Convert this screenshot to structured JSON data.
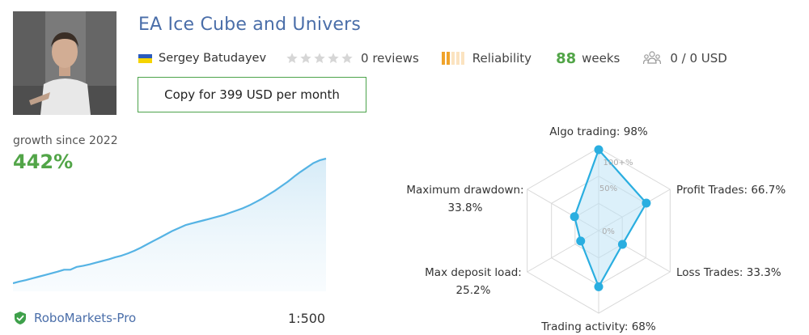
{
  "signal": {
    "title": "EA Ice Cube and Univers",
    "author": "Sergey Batudayev",
    "rating_stars": 0,
    "reviews": "0 reviews",
    "reliability_label": "Reliability",
    "weeks_value": "88",
    "weeks_label": "weeks",
    "subscribers": "0 / 0 USD",
    "copy_button": "Copy for 399 USD per month",
    "colors": {
      "title": "#4a6ea9",
      "accent_green": "#52a548",
      "reliability_bar": "#f0a32a",
      "chart_line": "#55b3e4"
    }
  },
  "growth": {
    "label": "growth since 2022",
    "value": "442%",
    "series": [
      0,
      6,
      11,
      17,
      23,
      29,
      35,
      41,
      48,
      48,
      58,
      62,
      67,
      73,
      79,
      85,
      92,
      98,
      106,
      115,
      126,
      138,
      150,
      162,
      174,
      186,
      196,
      206,
      212,
      218,
      224,
      230,
      236,
      242,
      250,
      258,
      266,
      276,
      288,
      300,
      314,
      328,
      344,
      360,
      378,
      395,
      410,
      426,
      436,
      442
    ]
  },
  "broker": {
    "name": "RoboMarkets-Pro",
    "leverage": "1:500"
  },
  "radar": {
    "scale_labels": [
      "100+%",
      "50%",
      "0%"
    ],
    "axes": [
      {
        "label": "Algo trading: 98%",
        "value": 98
      },
      {
        "label": "Profit Trades: 66.7%",
        "value": 66.7
      },
      {
        "label": "Loss Trades: 33.3%",
        "value": 33.3
      },
      {
        "label": "Trading activity: 68%",
        "value": 68
      },
      {
        "label_line1": "Max deposit load:",
        "label_line2": "25.2%",
        "value": 25.2
      },
      {
        "label_line1": "Maximum drawdown:",
        "label_line2": "33.8%",
        "value": 33.8
      }
    ]
  }
}
